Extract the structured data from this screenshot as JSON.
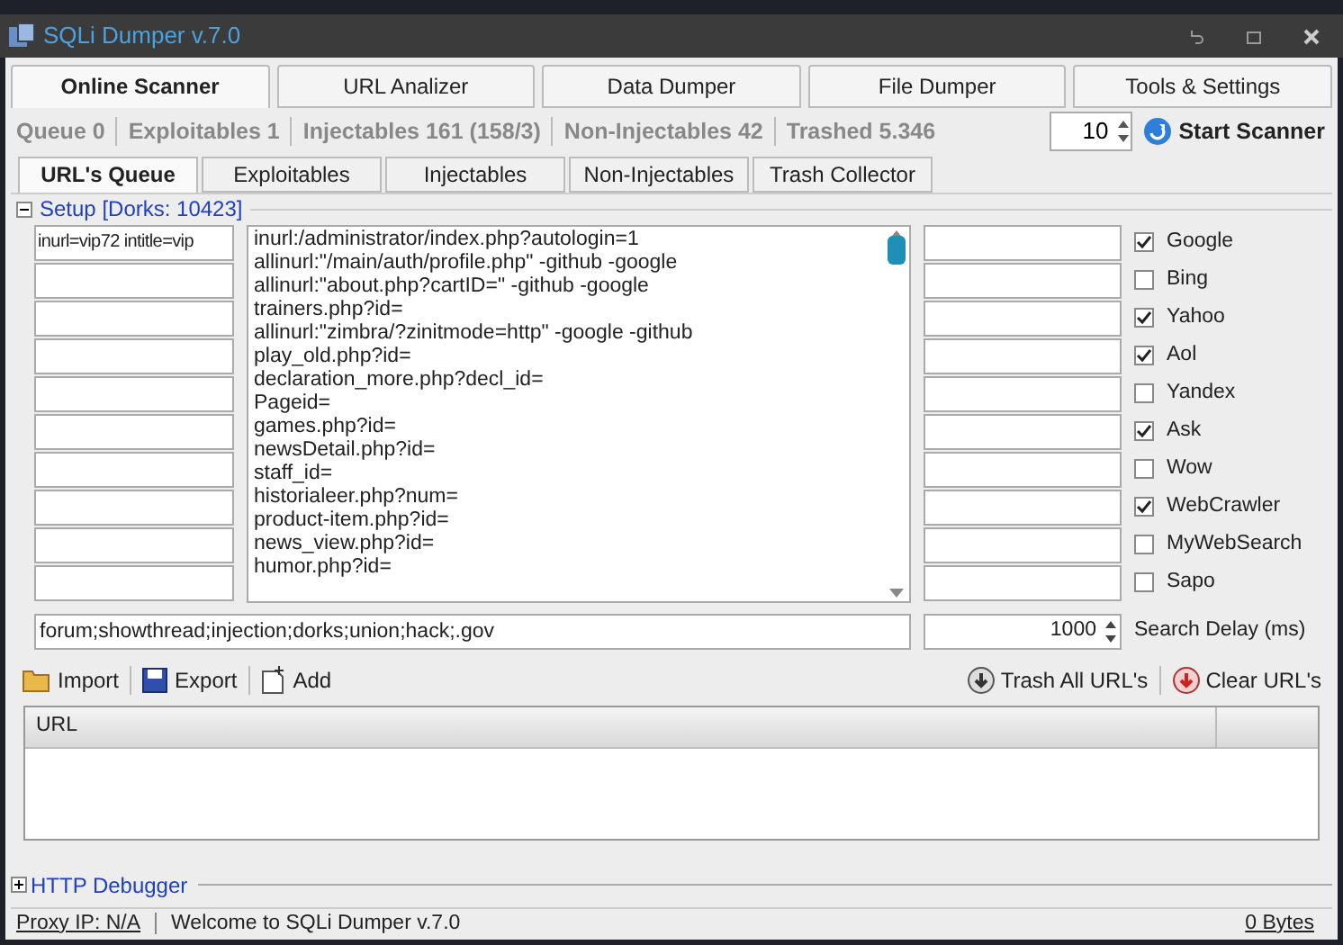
{
  "window": {
    "title": "SQLi Dumper v.7.0"
  },
  "main_tabs": [
    {
      "label": "Online Scanner",
      "selected": true
    },
    {
      "label": "URL Analizer",
      "selected": false
    },
    {
      "label": "Data Dumper",
      "selected": false
    },
    {
      "label": "File Dumper",
      "selected": false
    },
    {
      "label": "Tools & Settings",
      "selected": false
    }
  ],
  "stats": [
    "Queue 0",
    "Exploitables 1",
    "Injectables 161 (158/3)",
    "Non-Injectables 42",
    "Trashed 5.346"
  ],
  "threads": "10",
  "start_button": "Start Scanner",
  "sub_tabs": [
    {
      "label": "URL's Queue",
      "selected": true
    },
    {
      "label": "Exploitables",
      "selected": false
    },
    {
      "label": "Injectables",
      "selected": false
    },
    {
      "label": "Non-Injectables",
      "selected": false
    },
    {
      "label": "Trash Collector",
      "selected": false
    }
  ],
  "setup": {
    "title": "Setup [Dorks: 10423]",
    "expanded": true
  },
  "dork_fields": [
    "inurl=vip72 intitle=vip"
  ],
  "dorks": [
    "inurl:/administrator/index.php?autologin=1",
    "allinurl:\"/main/auth/profile.php\" -github -google",
    "allinurl:\"about.php?cartID=\" -github -google",
    "trainers.php?id=",
    "allinurl:\"zimbra/?zinitmode=http\" -google -github",
    "play_old.php?id=",
    "declaration_more.php?decl_id=",
    "Pageid=",
    "games.php?id=",
    "newsDetail.php?id=",
    "staff_id=",
    "historialeer.php?num=",
    "product-item.php?id=",
    "news_view.php?id=",
    "humor.php?id="
  ],
  "engines": [
    {
      "label": "Google",
      "checked": true
    },
    {
      "label": "Bing",
      "checked": false
    },
    {
      "label": "Yahoo",
      "checked": true
    },
    {
      "label": "Aol",
      "checked": true
    },
    {
      "label": "Yandex",
      "checked": false
    },
    {
      "label": "Ask",
      "checked": true
    },
    {
      "label": "Wow",
      "checked": false
    },
    {
      "label": "WebCrawler",
      "checked": true
    },
    {
      "label": "MyWebSearch",
      "checked": false
    },
    {
      "label": "Sapo",
      "checked": false
    }
  ],
  "keywords": "forum;showthread;injection;dorks;union;hack;.gov",
  "search_delay": {
    "value": "1000",
    "label": "Search Delay (ms)"
  },
  "toolbar_left": [
    {
      "kind": "folder",
      "label": "Import"
    },
    {
      "kind": "save",
      "label": "Export"
    },
    {
      "kind": "add",
      "label": "Add"
    }
  ],
  "toolbar_right": [
    {
      "kind": "trash",
      "label": "Trash All URL's"
    },
    {
      "kind": "clear",
      "label": "Clear URL's"
    }
  ],
  "table": {
    "columns": [
      "URL"
    ]
  },
  "http_debugger": {
    "title": "HTTP Debugger",
    "expanded": false
  },
  "status_bar": {
    "proxy": "Proxy IP: N/A",
    "message": "Welcome to SQLi Dumper v.7.0",
    "bytes": "0 Bytes"
  }
}
